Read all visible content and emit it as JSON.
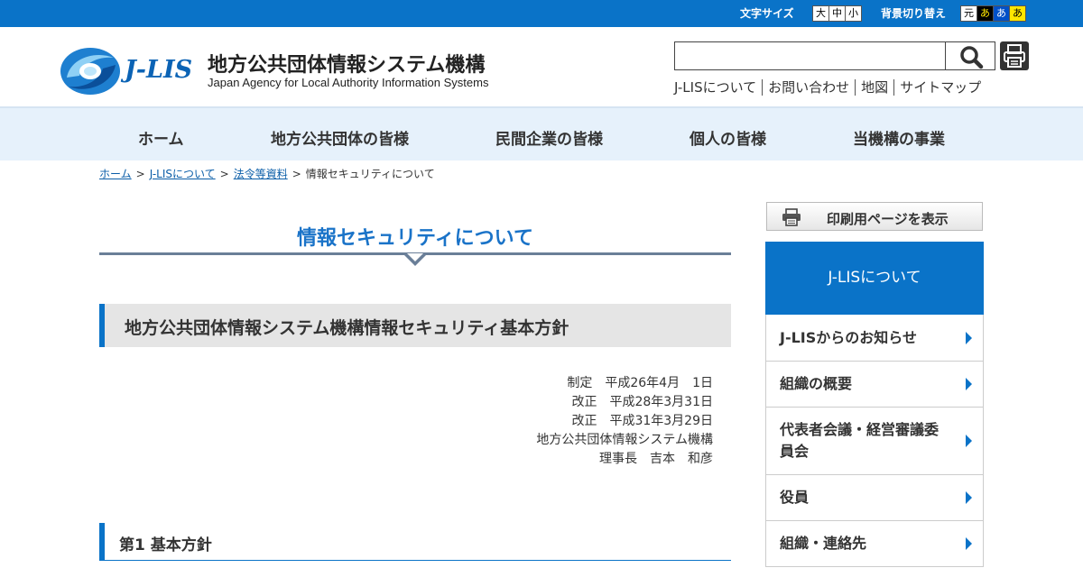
{
  "utility": {
    "font_size_label": "文字サイズ",
    "font_size_buttons": [
      "大",
      "中",
      "小"
    ],
    "bg_label": "背景切り替え",
    "bg_buttons": [
      "元",
      "あ",
      "あ",
      "あ"
    ]
  },
  "header": {
    "logo_text": "J-LIS",
    "org_name": "地方公共団体情報システム機構",
    "org_name_en": "Japan Agency for Local Authority Information Systems",
    "search_value": "",
    "links": [
      "J-LISについて",
      "お問い合わせ",
      "地図",
      "サイトマップ"
    ]
  },
  "nav": {
    "items": [
      "ホーム",
      "地方公共団体の皆様",
      "民間企業の皆様",
      "個人の皆様",
      "当機構の事業"
    ]
  },
  "breadcrumb": {
    "links": [
      "ホーム",
      "J-LISについて",
      "法令等資料"
    ],
    "sep": ">",
    "current": "情報セキュリティについて"
  },
  "main": {
    "title": "情報セキュリティについて",
    "heading": "地方公共団体情報システム機構情報セキュリティ基本方針",
    "meta": [
      "制定　平成26年4月　1日",
      "改正　平成28年3月31日",
      "改正　平成31年3月29日",
      "地方公共団体情報システム機構",
      "理事長　吉本　和彦"
    ],
    "section_heading": "第1 基本方針"
  },
  "sidebar": {
    "print_label": "印刷用ページを表示",
    "head": "J-LISについて",
    "items": [
      "J-LISからのお知らせ",
      "組織の概要",
      "代表者会議・経営審議委員会",
      "役員",
      "組織・連絡先"
    ]
  },
  "colors": {
    "brand_blue": "#0a73c8",
    "nav_bg": "#e6f1fb",
    "title_blue": "#1a73c8"
  },
  "icons": [
    "search-icon",
    "printer-icon",
    "arrow-right-icon"
  ]
}
